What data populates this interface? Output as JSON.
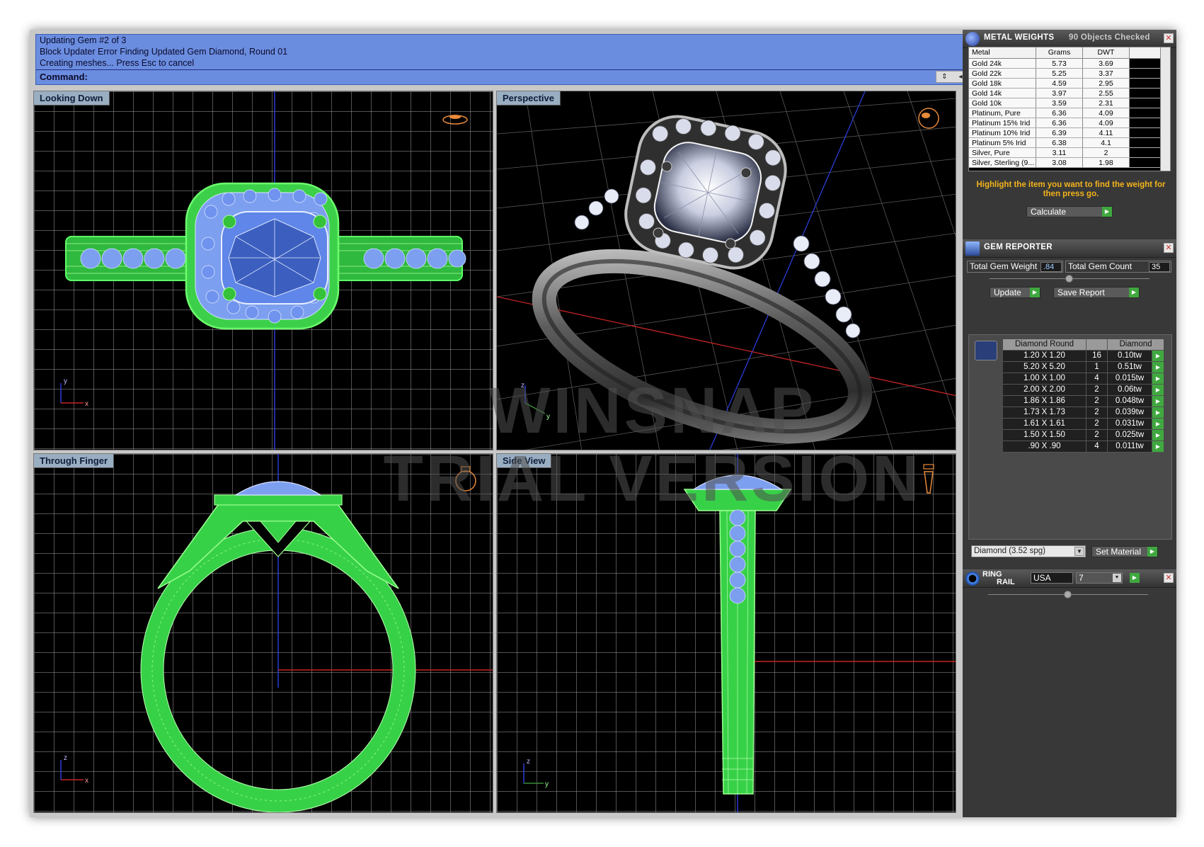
{
  "command_area": {
    "lines": [
      "Updating Gem #2 of 3",
      "Block Updater Error Finding Updated Gem Diamond, Round 01",
      "Creating meshes... Press Esc to cancel"
    ],
    "command_label": "Command:"
  },
  "viewports": {
    "top_left": "Looking Down",
    "top_right": "Perspective",
    "bottom_left": "Through Finger",
    "bottom_right": "Side View"
  },
  "axes": {
    "vp1": [
      "y",
      "x"
    ],
    "vp2": [
      "z",
      "y"
    ],
    "vp3": [
      "z",
      "x"
    ],
    "vp4": [
      "z",
      "y"
    ]
  },
  "watermark": {
    "line1": "WINSNAP",
    "line2": "TRIAL VERSION"
  },
  "metal_weights": {
    "title": "METAL WEIGHTS",
    "status": "90 Objects Checked",
    "columns": [
      "Metal",
      "Grams",
      "DWT"
    ],
    "rows": [
      [
        "Gold 24k",
        "5.73",
        "3.69"
      ],
      [
        "Gold 22k",
        "5.25",
        "3.37"
      ],
      [
        "Gold 18k",
        "4.59",
        "2.95"
      ],
      [
        "Gold 14k",
        "3.97",
        "2.55"
      ],
      [
        "Gold 10k",
        "3.59",
        "2.31"
      ],
      [
        "Platinum, Pure",
        "6.36",
        "4.09"
      ],
      [
        "Platinum 15% Irid",
        "6.36",
        "4.09"
      ],
      [
        "Platinum 10% Irid",
        "6.39",
        "4.11"
      ],
      [
        "Platinum 5% Irid",
        "6.38",
        "4.1"
      ],
      [
        "Silver, Pure",
        "3.11",
        "2"
      ],
      [
        "Silver, Sterling (9...",
        "3.08",
        "1.98"
      ]
    ],
    "hint_line1": "Highlight the item you want to find the weight for",
    "hint_line2": "then press go.",
    "calculate_label": "Calculate"
  },
  "gem_reporter": {
    "title": "GEM REPORTER",
    "total_weight_label": "Total Gem Weight",
    "total_weight_value": ".84",
    "total_count_label": "Total Gem Count",
    "total_count_value": "35",
    "update_label": "Update",
    "save_report_label": "Save Report",
    "columns": [
      "Diamond Round",
      "Diamond"
    ],
    "rows": [
      [
        "1.20 X 1.20",
        "16",
        "0.10tw"
      ],
      [
        "5.20 X 5.20",
        "1",
        "0.51tw"
      ],
      [
        "1.00 X 1.00",
        "4",
        "0.015tw"
      ],
      [
        "2.00 X 2.00",
        "2",
        "0.06tw"
      ],
      [
        "1.86 X 1.86",
        "2",
        "0.048tw"
      ],
      [
        "1.73 X 1.73",
        "2",
        "0.039tw"
      ],
      [
        "1.61 X 1.61",
        "2",
        "0.031tw"
      ],
      [
        "1.50 X 1.50",
        "2",
        "0.025tw"
      ],
      [
        ".90 X .90",
        "4",
        "0.011tw"
      ]
    ],
    "material_select": "Diamond    (3.52 spg)",
    "set_material_label": "Set Material"
  },
  "ring_rail": {
    "title_line1": "RING",
    "title_line2": "RAIL",
    "region": "USA",
    "size": "7"
  },
  "colors": {
    "command_bg": "#6b8de0",
    "wire_green": "#39d84a",
    "gem_blue": "#7d9ff0",
    "panel_bg": "#383838",
    "hint_orange": "#f3b41c"
  }
}
